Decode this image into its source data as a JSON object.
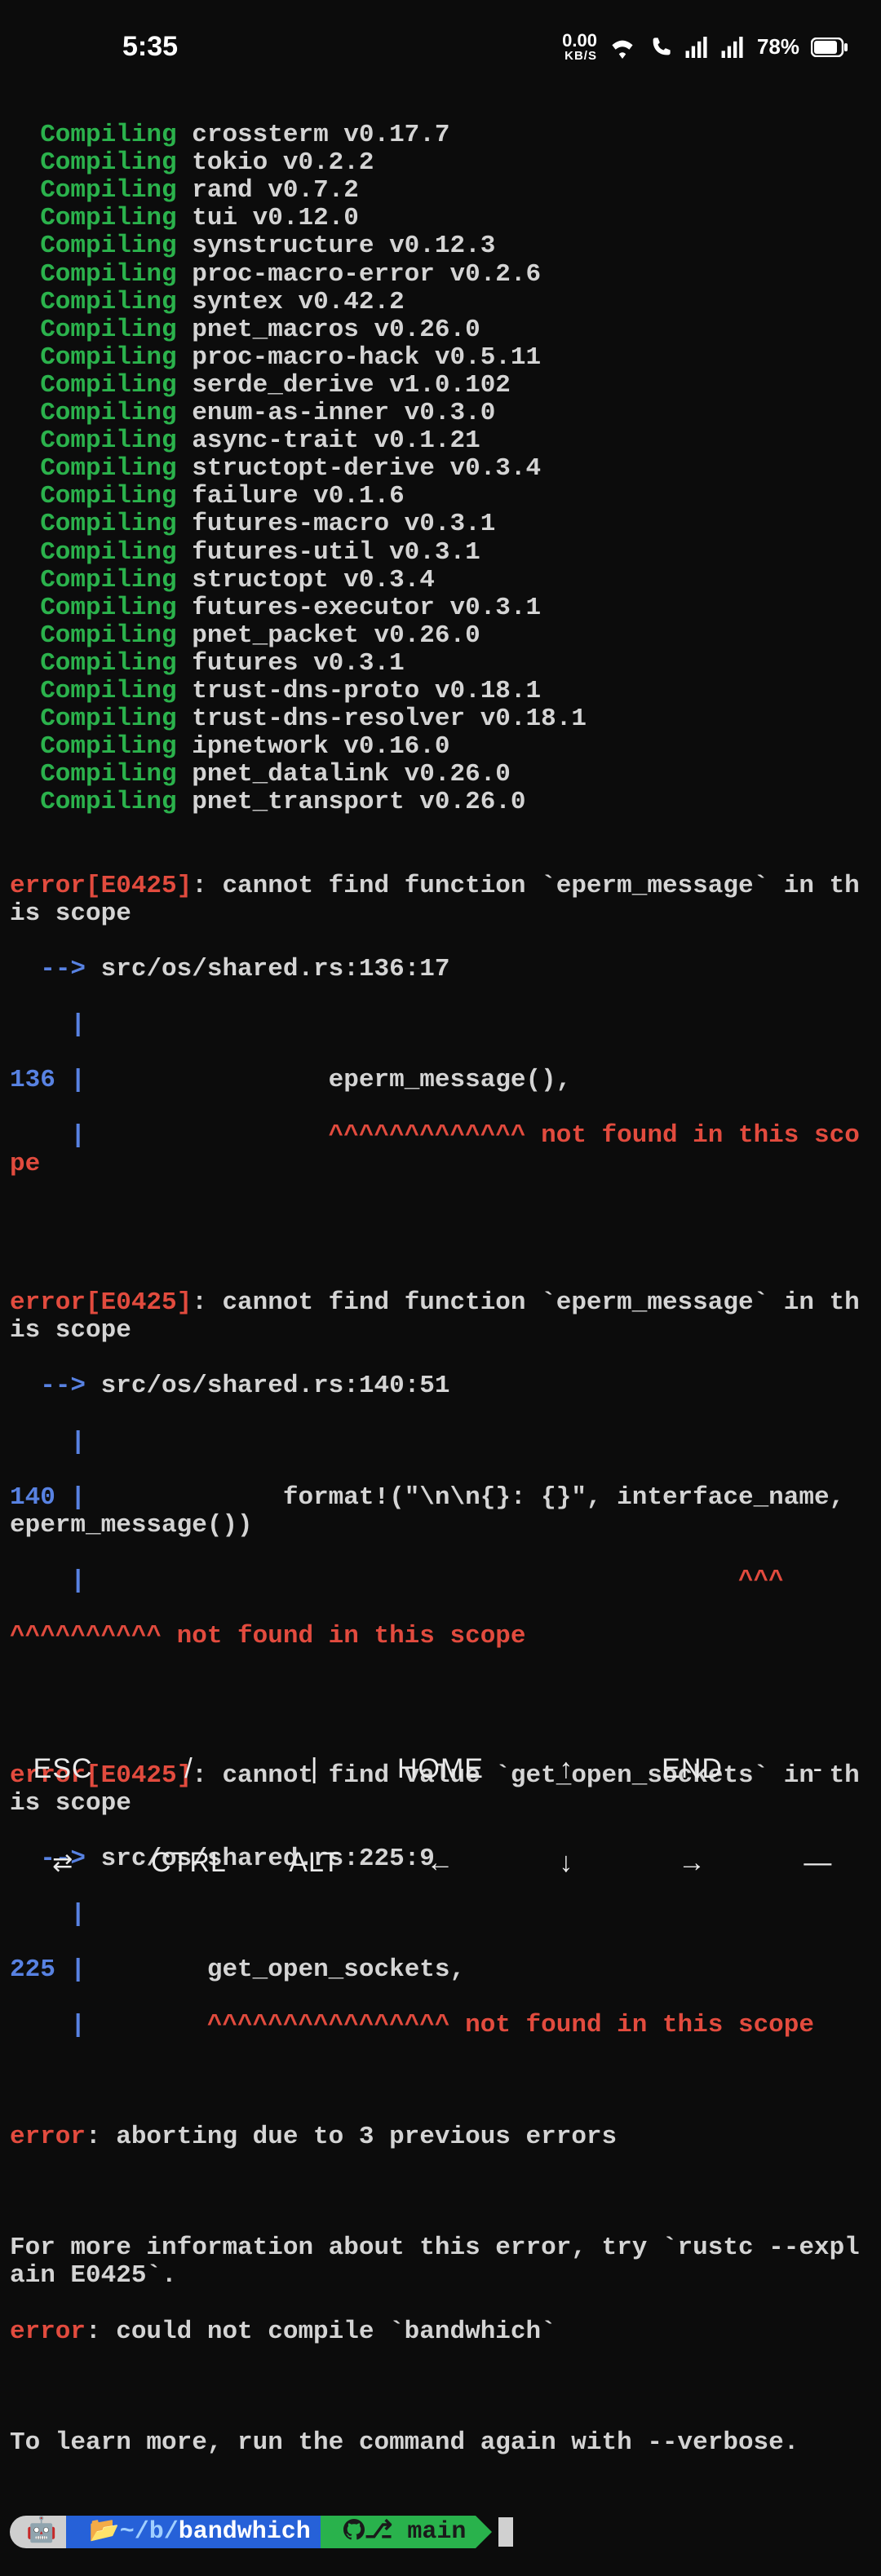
{
  "status": {
    "time": "5:35",
    "kbs_top": "0.00",
    "kbs_bot": "KB/S",
    "battery": "78%"
  },
  "compiling_label": "Compiling",
  "compiling": [
    "crossterm v0.17.7",
    "tokio v0.2.2",
    "rand v0.7.2",
    "tui v0.12.0",
    "synstructure v0.12.3",
    "proc-macro-error v0.2.6",
    "syntex v0.42.2",
    "pnet_macros v0.26.0",
    "proc-macro-hack v0.5.11",
    "serde_derive v1.0.102",
    "enum-as-inner v0.3.0",
    "async-trait v0.1.21",
    "structopt-derive v0.3.4",
    "failure v0.1.6",
    "futures-macro v0.3.1",
    "futures-util v0.3.1",
    "structopt v0.3.4",
    "futures-executor v0.3.1",
    "pnet_packet v0.26.0",
    "futures v0.3.1",
    "trust-dns-proto v0.18.1",
    "trust-dns-resolver v0.18.1",
    "ipnetwork v0.16.0",
    "pnet_datalink v0.26.0",
    "pnet_transport v0.26.0"
  ],
  "errors": {
    "e1": {
      "prefix": "error[",
      "code": "E0425",
      "suffix": "]",
      "msg": ": cannot find function `eperm_message` in this scope",
      "loc": " src/os/shared.rs:136:17",
      "lineno": "136 ",
      "codeline": "                eperm_message(),",
      "carets": "                ^^^^^^^^^^^^^",
      "notfound": " not found in this scope"
    },
    "e2": {
      "prefix": "error[",
      "code": "E0425",
      "suffix": "]",
      "msg": ": cannot find function `eperm_message` in this scope",
      "loc": " src/os/shared.rs:140:51",
      "lineno": "140 ",
      "codeline": "             format!(\"\\n\\n{}: {}\", interface_name, eperm_message())",
      "carets_tail": "                                           ^^^",
      "carets_lead": "^^^^^^^^^^",
      "notfound": " not found in this scope"
    },
    "e3": {
      "prefix": "error[",
      "code": "E0425",
      "suffix": "]",
      "msg": ": cannot find value `get_open_sockets` in this scope",
      "loc": " src/os/shared.rs:225:9",
      "lineno": "225 ",
      "codeline": "        get_open_sockets,",
      "carets": "        ^^^^^^^^^^^^^^^^",
      "notfound": " not found in this scope"
    },
    "abort": {
      "prefix": "error",
      "msg": ": aborting due to 3 previous errors"
    },
    "info": "For more information about this error, try `rustc --explain E0425`.",
    "compilefail": {
      "prefix": "error",
      "msg": ": could not compile `bandwhich`"
    },
    "learn": "To learn more, run the command again with --verbose."
  },
  "prompt": {
    "path_prefix": "📂~/b/",
    "path_bold": "bandwhich",
    "branch": " main"
  },
  "keys": {
    "row1": [
      "ESC",
      "/",
      "|",
      "HOME",
      "↑",
      "END",
      "-"
    ],
    "row2": [
      "⇄",
      "CTRL",
      "ALT",
      "←",
      "↓",
      "→",
      "—"
    ]
  }
}
